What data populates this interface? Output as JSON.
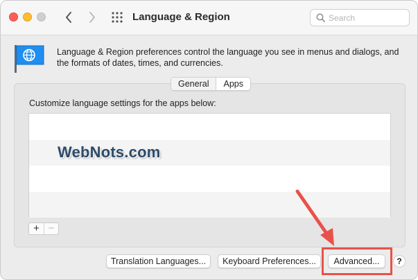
{
  "window": {
    "title": "Language & Region",
    "search": {
      "placeholder": "Search",
      "value": ""
    }
  },
  "header": {
    "description": "Language & Region preferences control the language you see in menus and dialogs, and the formats of dates, times, and currencies."
  },
  "tabs": [
    {
      "label": "General",
      "selected": false
    },
    {
      "label": "Apps",
      "selected": true
    }
  ],
  "apps_panel": {
    "instruction": "Customize language settings for the apps below:",
    "rows": [],
    "add_label": "+",
    "remove_label": "−"
  },
  "watermark": "WebNots.com",
  "buttons": {
    "translation": "Translation Languages...",
    "keyboard": "Keyboard Preferences...",
    "advanced": "Advanced...",
    "help": "?"
  },
  "colors": {
    "highlight": "#e8524a",
    "close": "#ff5f57",
    "minimize": "#febc2e",
    "flag": "#1f8ef0"
  }
}
